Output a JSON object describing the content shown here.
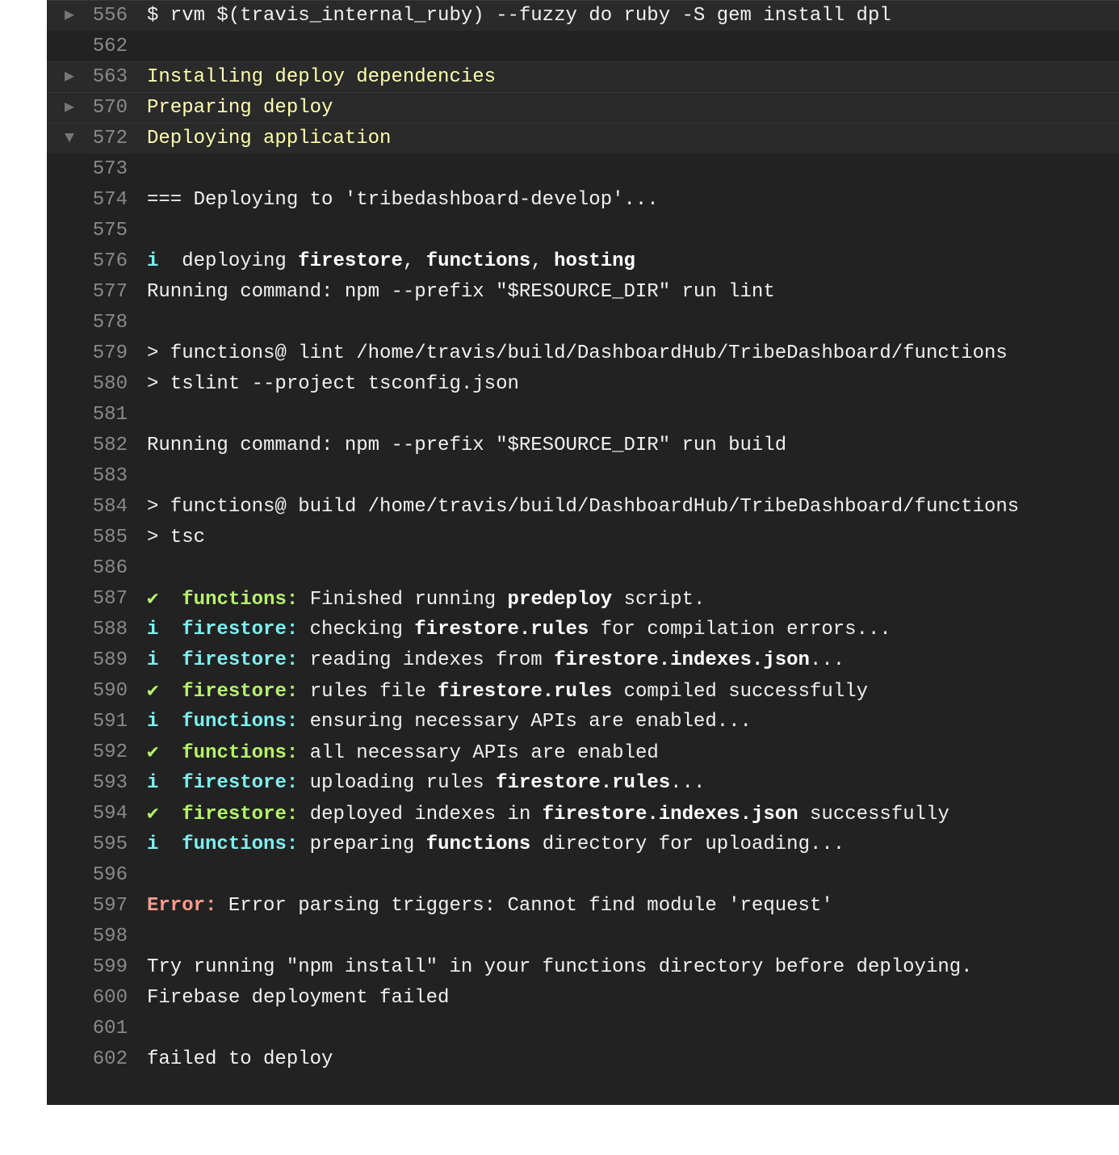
{
  "log": {
    "folds": {
      "f556": {
        "num": "556",
        "toggle": "▶",
        "text": "$ rvm $(travis_internal_ruby) --fuzzy do ruby -S gem install dpl"
      },
      "f563": {
        "num": "563",
        "toggle": "▶",
        "text": "Installing deploy dependencies"
      },
      "f570": {
        "num": "570",
        "toggle": "▶",
        "text": "Preparing deploy"
      },
      "f572": {
        "num": "572",
        "toggle": "▼",
        "text": "Deploying application"
      }
    },
    "lines": {
      "l562": {
        "num": "562"
      },
      "l573": {
        "num": "573"
      },
      "l574": {
        "num": "574",
        "text": "=== Deploying to 'tribedashboard-develop'..."
      },
      "l575": {
        "num": "575"
      },
      "l576": {
        "num": "576",
        "icon": "i",
        "a": " deploying ",
        "b1": "firestore",
        "c": ", ",
        "b2": "functions",
        "d": ", ",
        "b3": "hosting"
      },
      "l577": {
        "num": "577",
        "text": "Running command: npm --prefix \"$RESOURCE_DIR\" run lint"
      },
      "l578": {
        "num": "578"
      },
      "l579": {
        "num": "579",
        "text": "> functions@ lint /home/travis/build/DashboardHub/TribeDashboard/functions"
      },
      "l580": {
        "num": "580",
        "text": "> tslint --project tsconfig.json"
      },
      "l581": {
        "num": "581"
      },
      "l582": {
        "num": "582",
        "text": "Running command: npm --prefix \"$RESOURCE_DIR\" run build"
      },
      "l583": {
        "num": "583"
      },
      "l584": {
        "num": "584",
        "text": "> functions@ build /home/travis/build/DashboardHub/TribeDashboard/functions"
      },
      "l585": {
        "num": "585",
        "text": "> tsc"
      },
      "l586": {
        "num": "586"
      },
      "l587": {
        "num": "587",
        "icon": "✔",
        "tag": "functions:",
        "a": " Finished running ",
        "b1": "predeploy",
        "c": " script."
      },
      "l588": {
        "num": "588",
        "icon": "i",
        "tag": "firestore:",
        "a": " checking ",
        "b1": "firestore.rules",
        "c": " for compilation errors..."
      },
      "l589": {
        "num": "589",
        "icon": "i",
        "tag": "firestore:",
        "a": " reading indexes from ",
        "b1": "firestore.indexes.json",
        "c": "..."
      },
      "l590": {
        "num": "590",
        "icon": "✔",
        "tag": "firestore:",
        "a": " rules file ",
        "b1": "firestore.rules",
        "c": " compiled successfully"
      },
      "l591": {
        "num": "591",
        "icon": "i",
        "tag": "functions:",
        "a": " ensuring necessary APIs are enabled..."
      },
      "l592": {
        "num": "592",
        "icon": "✔",
        "tag": "functions:",
        "a": " all necessary APIs are enabled"
      },
      "l593": {
        "num": "593",
        "icon": "i",
        "tag": "firestore:",
        "a": " uploading rules ",
        "b1": "firestore.rules",
        "c": "..."
      },
      "l594": {
        "num": "594",
        "icon": "✔",
        "tag": "firestore:",
        "a": " deployed indexes in ",
        "b1": "firestore.indexes.json",
        "c": " successfully"
      },
      "l595": {
        "num": "595",
        "icon": "i",
        "tag": "functions:",
        "a": " preparing ",
        "b1": "functions",
        "c": " directory for uploading..."
      },
      "l596": {
        "num": "596"
      },
      "l597": {
        "num": "597",
        "tag": "Error:",
        "a": " Error parsing triggers: Cannot find module 'request'"
      },
      "l598": {
        "num": "598"
      },
      "l599": {
        "num": "599",
        "text": "Try running \"npm install\" in your functions directory before deploying."
      },
      "l600": {
        "num": "600",
        "text": "Firebase deployment failed"
      },
      "l601": {
        "num": "601"
      },
      "l602": {
        "num": "602",
        "text": "failed to deploy"
      }
    }
  }
}
